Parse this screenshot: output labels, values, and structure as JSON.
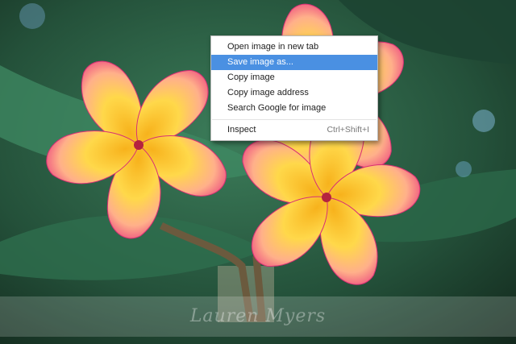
{
  "photo": {
    "subject": "pink and yellow plumeria flowers"
  },
  "watermark": {
    "text": "Lauren Myers"
  },
  "context_menu": {
    "items": [
      {
        "label": "Open image in new tab",
        "shortcut": "",
        "active": false
      },
      {
        "label": "Save image as...",
        "shortcut": "",
        "active": true
      },
      {
        "label": "Copy image",
        "shortcut": "",
        "active": false
      },
      {
        "label": "Copy image address",
        "shortcut": "",
        "active": false
      },
      {
        "label": "Search Google for image",
        "shortcut": "",
        "active": false
      }
    ],
    "inspect": {
      "label": "Inspect",
      "shortcut": "Ctrl+Shift+I"
    },
    "highlight_color": "#4a90e2"
  }
}
